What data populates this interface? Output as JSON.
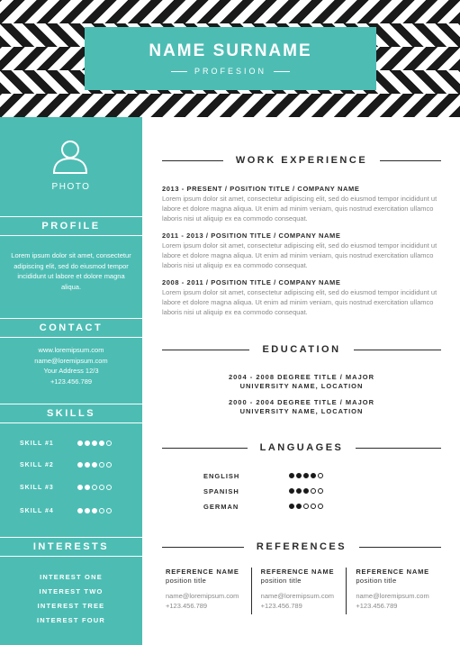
{
  "header": {
    "name": "NAME SURNAME",
    "profession": "PROFESION"
  },
  "colors": {
    "accent": "#4dbdb4",
    "pattern_dark": "#1a1a1a",
    "text": "#2b2b2b",
    "muted": "#8a8a8a"
  },
  "sidebar": {
    "photo_label": "PHOTO",
    "profile": {
      "heading": "PROFILE",
      "text": "Lorem ipsum dolor sit amet, consectetur adipiscing elit, sed do eiusmod tempor incididunt ut labore et dolore magna aliqua."
    },
    "contact": {
      "heading": "CONTACT",
      "lines": [
        "www.loremipsum.com",
        "name@loremipsum.com",
        "Your Address 12/3",
        "+123.456.789"
      ]
    },
    "skills": {
      "heading": "SKILLS",
      "items": [
        {
          "name": "SKILL #1",
          "level": 4
        },
        {
          "name": "SKILL #2",
          "level": 3
        },
        {
          "name": "SKILL #3",
          "level": 2
        },
        {
          "name": "SKILL #4",
          "level": 3
        }
      ],
      "max": 5
    },
    "interests": {
      "heading": "INTERESTS",
      "items": [
        "INTEREST ONE",
        "INTEREST TWO",
        "INTEREST TREE",
        "INTEREST FOUR"
      ]
    }
  },
  "work": {
    "heading": "WORK EXPERIENCE",
    "jobs": [
      {
        "title": "2013 - PRESENT / POSITION TITLE / COMPANY NAME",
        "desc": "Lorem ipsum dolor sit amet, consectetur adipiscing elit, sed do eiusmod tempor incididunt ut labore et dolore magna aliqua. Ut enim ad minim veniam, quis nostrud exercitation ullamco laboris nisi ut aliquip ex ea commodo consequat."
      },
      {
        "title": "2011 - 2013 / POSITION TITLE / COMPANY NAME",
        "desc": "Lorem ipsum dolor sit amet, consectetur adipiscing elit, sed do eiusmod tempor incididunt ut labore et dolore magna aliqua. Ut enim ad minim veniam, quis nostrud exercitation ullamco laboris nisi ut aliquip ex ea commodo consequat."
      },
      {
        "title": "2008 - 2011 / POSITION TITLE / COMPANY NAME",
        "desc": "Lorem ipsum dolor sit amet, consectetur adipiscing elit, sed do eiusmod tempor incididunt ut labore et dolore magna aliqua. Ut enim ad minim veniam, quis nostrud exercitation ullamco laboris nisi ut aliquip ex ea commodo consequat."
      }
    ]
  },
  "education": {
    "heading": "EDUCATION",
    "items": [
      {
        "line1": "2004 - 2008 DEGREE TITLE / MAJOR",
        "line2": "UNIVERSITY NAME, LOCATION"
      },
      {
        "line1": "2000 - 2004 DEGREE TITLE / MAJOR",
        "line2": "UNIVERSITY NAME, LOCATION"
      }
    ]
  },
  "languages": {
    "heading": "LANGUAGES",
    "items": [
      {
        "name": "ENGLISH",
        "level": 4
      },
      {
        "name": "SPANISH",
        "level": 3
      },
      {
        "name": "GERMAN",
        "level": 2
      }
    ],
    "max": 5
  },
  "references": {
    "heading": "REFERENCES",
    "items": [
      {
        "name": "REFERENCE NAME",
        "position": "position title",
        "email": "name@loremipsum.com",
        "phone": "+123.456.789"
      },
      {
        "name": "REFERENCE NAME",
        "position": "position title",
        "email": "name@loremipsum.com",
        "phone": "+123.456.789"
      },
      {
        "name": "REFERENCE NAME",
        "position": "position title",
        "email": "name@loremipsum.com",
        "phone": "+123.456.789"
      }
    ]
  }
}
